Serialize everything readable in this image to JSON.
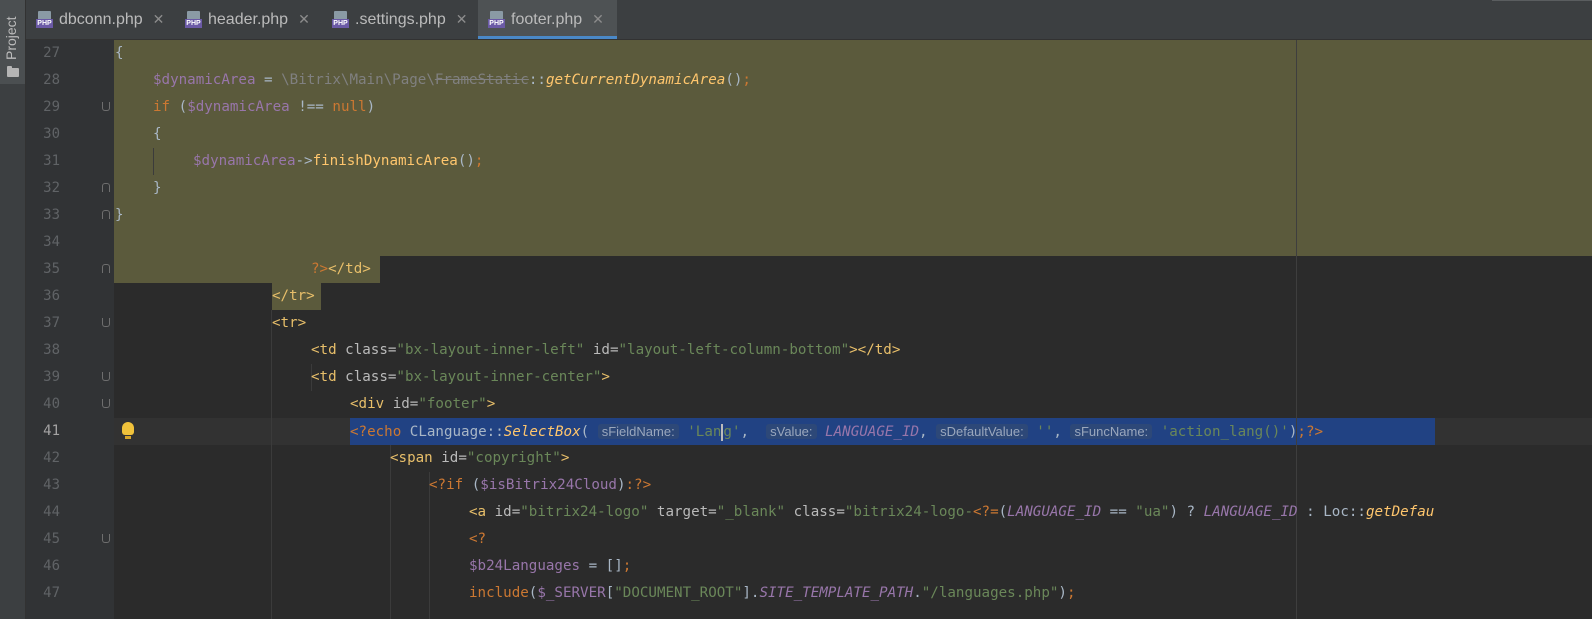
{
  "sidebar": {
    "label": "Project"
  },
  "tabs": [
    {
      "label": "dbconn.php",
      "active": false
    },
    {
      "label": "header.php",
      "active": false
    },
    {
      "label": ".settings.php",
      "active": false
    },
    {
      "label": "footer.php",
      "active": true
    }
  ],
  "tab_close_glyph": "✕",
  "file_icon_text": "PHP",
  "editor": {
    "current_line": 41,
    "line_numbers": [
      "27",
      "28",
      "29",
      "30",
      "31",
      "32",
      "33",
      "34",
      "35",
      "36",
      "37",
      "38",
      "39",
      "40",
      "41",
      "42",
      "43",
      "44",
      "45",
      "46",
      "47"
    ]
  },
  "colors": {
    "keyword": "#cc7832",
    "variable": "#9876aa",
    "function": "#ffc66d",
    "string": "#6a8759",
    "tag": "#e8bf6a",
    "selection": "#5b5a3c",
    "blue_selection": "#214283",
    "accent": "#4a88c7"
  }
}
